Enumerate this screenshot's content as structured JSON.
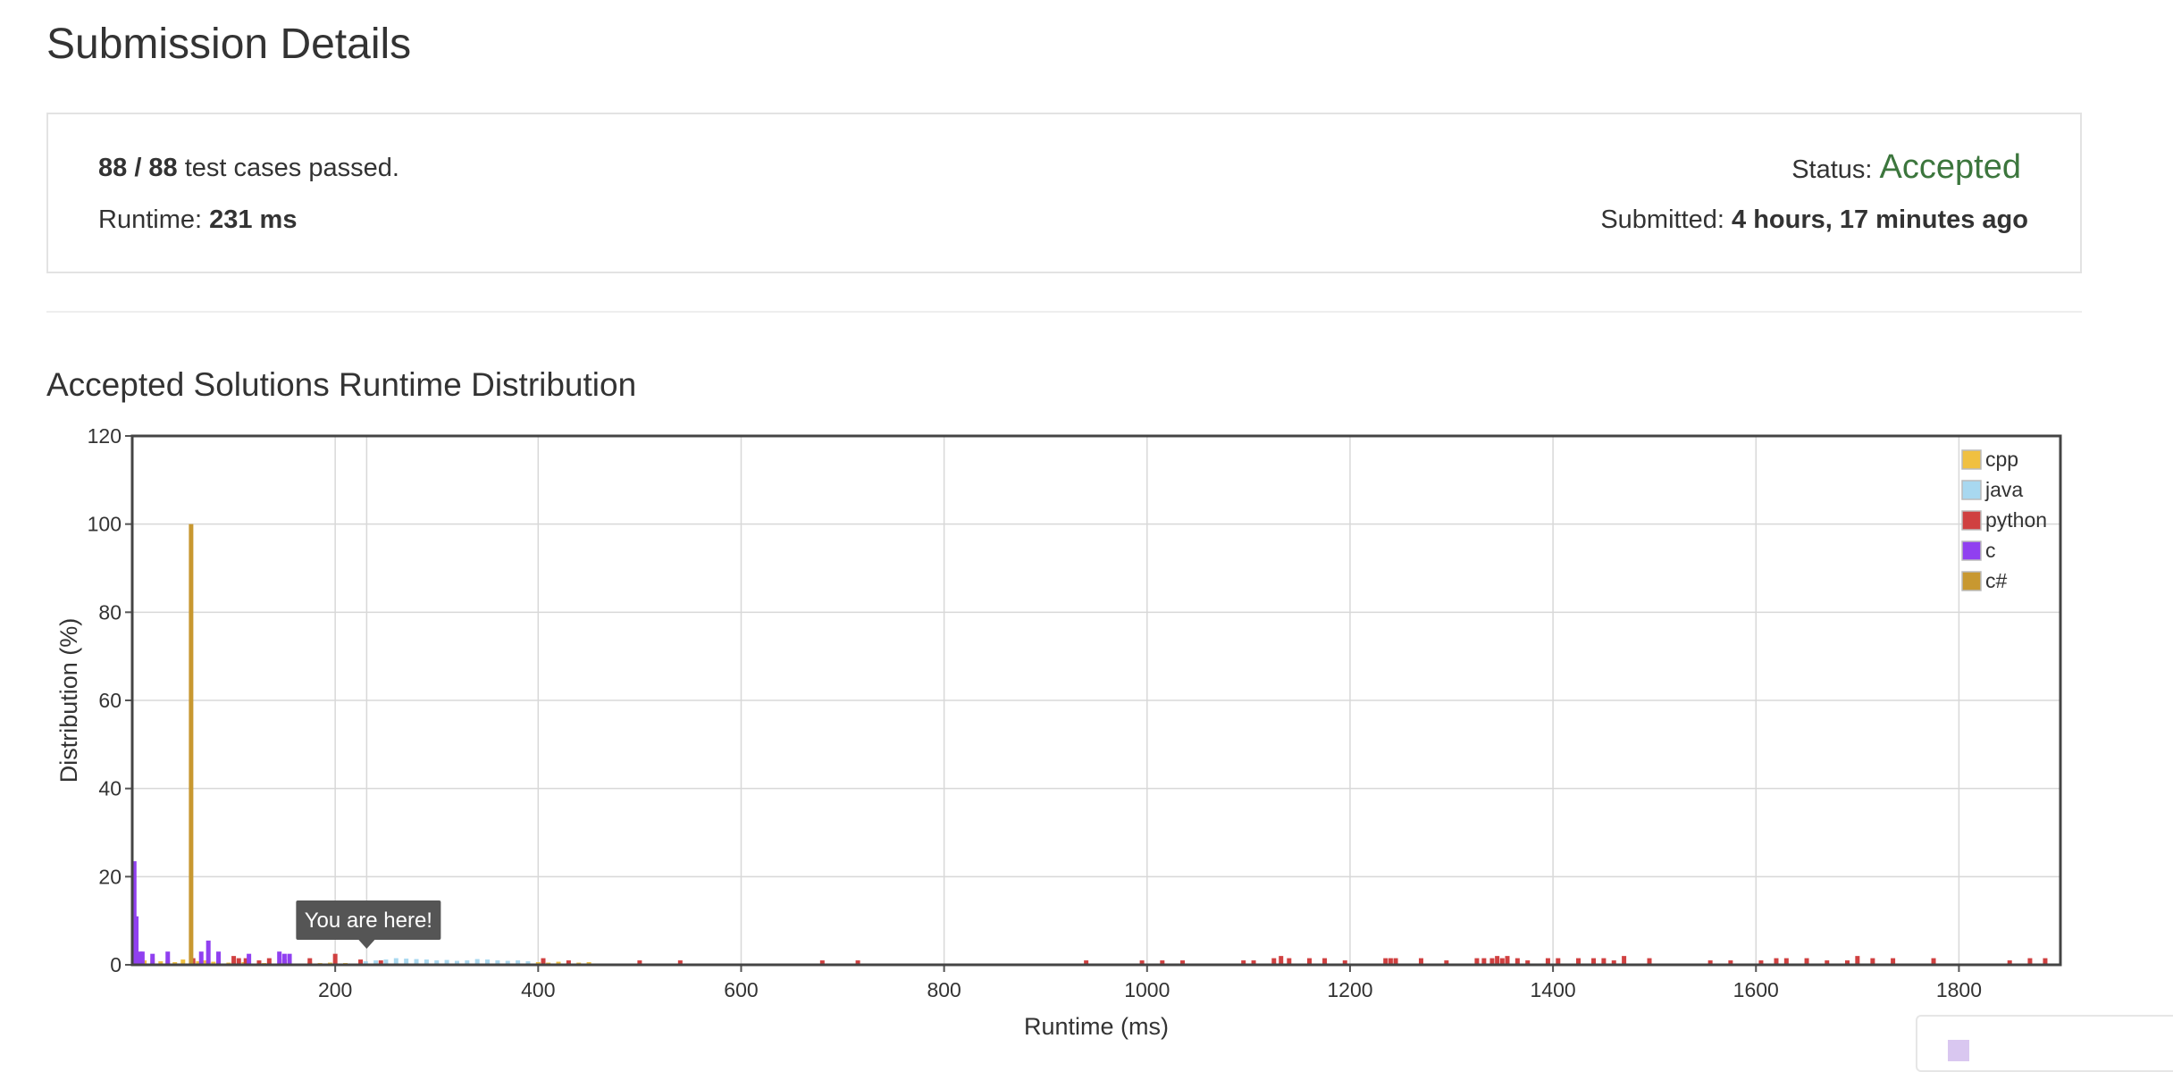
{
  "page": {
    "title": "Submission Details"
  },
  "details": {
    "passed": "88 / 88",
    "passed_suffix": " test cases passed.",
    "runtime_label": "Runtime: ",
    "runtime_value": "231 ms",
    "status_label": "Status: ",
    "status_value": "Accepted",
    "submitted_label": "Submitted: ",
    "submitted_value": "4 hours, 17 minutes ago"
  },
  "chart_section": {
    "title": "Accepted Solutions Runtime Distribution"
  },
  "chart_data": {
    "type": "bar",
    "title": "Accepted Solutions Runtime Distribution",
    "xlabel": "Runtime (ms)",
    "ylabel": "Distribution (%)",
    "xlim": [
      0,
      1900
    ],
    "ylim": [
      0,
      120
    ],
    "xticks": [
      200,
      400,
      600,
      800,
      1000,
      1200,
      1400,
      1600,
      1800
    ],
    "yticks": [
      0,
      20,
      40,
      60,
      80,
      100,
      120
    ],
    "grid": true,
    "legend_position": "top-right",
    "annotation": {
      "text": "You are here!",
      "x": 231
    },
    "colors": {
      "cpp": "#f0c040",
      "java": "#a8d8f0",
      "python": "#d04040",
      "c": "#9040f0",
      "c#": "#c89830"
    },
    "series": [
      {
        "name": "cpp",
        "x": [
          3,
          12,
          20,
          28,
          35,
          42,
          50,
          65,
          72,
          80,
          95,
          110,
          130,
          150,
          175,
          185,
          195,
          210,
          220,
          400,
          410,
          420,
          430,
          440,
          450,
          460
        ],
        "values": [
          1.2,
          1.0,
          1.5,
          0.8,
          1.0,
          0.6,
          1.2,
          0.8,
          1.0,
          0.7,
          0.5,
          0.6,
          0.4,
          0.5,
          0.6,
          0.4,
          0.5,
          0.4,
          0.3,
          0.6,
          0.5,
          0.7,
          0.4,
          0.5,
          0.6,
          0.3
        ]
      },
      {
        "name": "java",
        "x": [
          230,
          240,
          250,
          260,
          270,
          280,
          290,
          300,
          310,
          320,
          330,
          340,
          350,
          360,
          370,
          380,
          390
        ],
        "values": [
          0.8,
          1.0,
          1.2,
          1.5,
          1.4,
          1.3,
          1.2,
          1.0,
          1.1,
          0.9,
          1.0,
          1.3,
          1.2,
          1.0,
          0.9,
          1.0,
          0.8
        ]
      },
      {
        "name": "python",
        "x": [
          60,
          100,
          105,
          112,
          125,
          135,
          150,
          175,
          200,
          225,
          245,
          405,
          430,
          500,
          540,
          680,
          715,
          940,
          995,
          1015,
          1035,
          1095,
          1105,
          1125,
          1132,
          1140,
          1160,
          1175,
          1195,
          1235,
          1240,
          1245,
          1270,
          1295,
          1325,
          1332,
          1340,
          1345,
          1350,
          1355,
          1365,
          1375,
          1395,
          1405,
          1425,
          1440,
          1450,
          1460,
          1470,
          1495,
          1555,
          1575,
          1605,
          1620,
          1630,
          1650,
          1670,
          1690,
          1700,
          1715,
          1735,
          1775,
          1850,
          1870,
          1885
        ],
        "values": [
          1.5,
          2.0,
          1.5,
          1.5,
          1.0,
          1.5,
          1.2,
          1.5,
          2.5,
          1.2,
          1.0,
          1.5,
          1.0,
          1.0,
          1.0,
          1.0,
          1.0,
          1.0,
          1.0,
          1.0,
          1.0,
          1.0,
          1.0,
          1.5,
          2.0,
          1.5,
          1.5,
          1.5,
          1.0,
          1.5,
          1.5,
          1.5,
          1.5,
          1.0,
          1.5,
          1.5,
          1.5,
          2.0,
          1.5,
          2.0,
          1.5,
          1.0,
          1.5,
          1.5,
          1.5,
          1.5,
          1.5,
          1.0,
          2.0,
          1.5,
          1.0,
          1.0,
          1.0,
          1.5,
          1.5,
          1.5,
          1.0,
          1.0,
          2.0,
          1.5,
          1.5,
          1.5,
          1.0,
          1.5,
          1.5
        ]
      },
      {
        "name": "c",
        "x": [
          2,
          4,
          8,
          10,
          20,
          35,
          68,
          75,
          85,
          115,
          145,
          150,
          155
        ],
        "values": [
          23.5,
          11.0,
          3.0,
          3.0,
          2.5,
          3.0,
          3.0,
          5.5,
          3.0,
          2.5,
          3.0,
          2.5,
          2.5
        ]
      },
      {
        "name": "c#",
        "x": [
          58
        ],
        "values": [
          100
        ]
      }
    ]
  }
}
